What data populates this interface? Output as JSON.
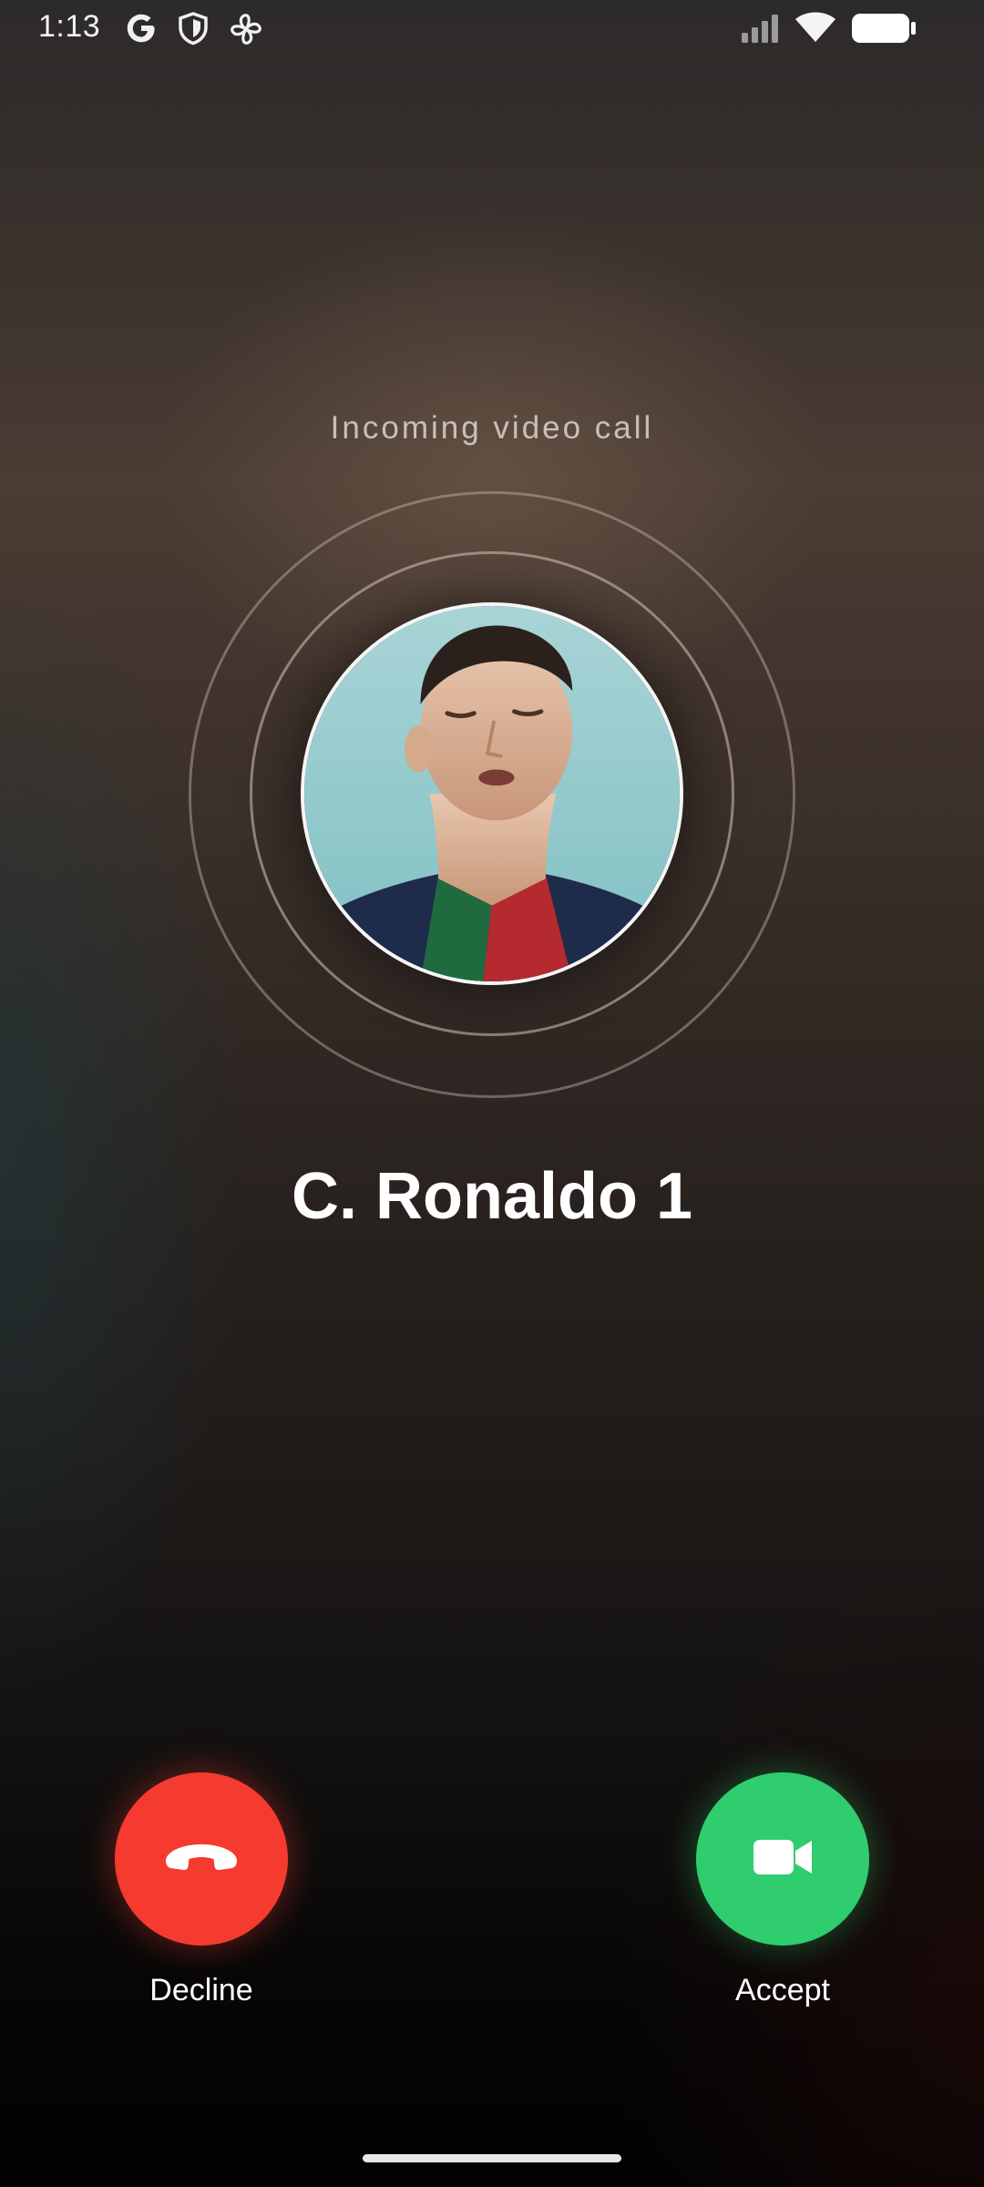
{
  "status_bar": {
    "time": "1:13",
    "left_icons": [
      "google-g-icon",
      "shield-icon",
      "fan-icon"
    ],
    "right_icons": [
      "signal-icon",
      "wifi-icon",
      "battery-icon"
    ]
  },
  "call": {
    "label": "Incoming video call",
    "caller_name": "C. Ronaldo 1"
  },
  "actions": {
    "decline_label": "Decline",
    "accept_label": "Accept"
  },
  "colors": {
    "decline": "#f53a2f",
    "accept": "#2fcd6e"
  }
}
